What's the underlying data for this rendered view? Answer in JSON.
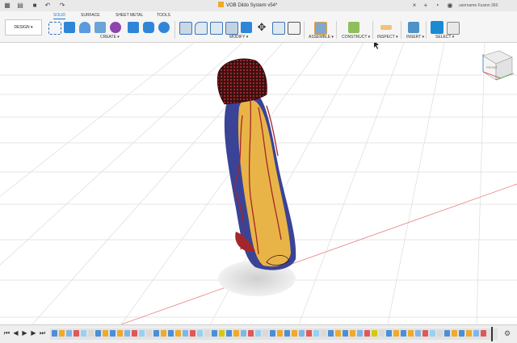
{
  "window": {
    "title": "VOB Dildo System v54*",
    "user": "username Fusion 360"
  },
  "toolbar": {
    "tabs": [
      "SOLID",
      "SURFACE",
      "SHEET METAL",
      "TOOLS"
    ],
    "active_tab": "SOLID",
    "workspace": "DESIGN ▾",
    "groups": [
      "CREATE ▾",
      "MODIFY ▾",
      "ASSEMBLE ▾",
      "CONSTRUCT ▾",
      "INSPECT ▾",
      "INSERT ▾",
      "SELECT ▾"
    ]
  },
  "icons": {
    "app_grid": "grid-icon",
    "file": "file-icon",
    "save": "save-icon",
    "undo": "undo-icon",
    "redo": "redo-icon",
    "close_tab": "close-icon",
    "new_tab": "plus-icon",
    "settings": "gear-icon"
  },
  "colors": {
    "accent": "#1a7ad4",
    "model_blue": "#3a4396",
    "model_yellow": "#e9b447",
    "model_red": "#a3262a",
    "tab_underline": "#1a7ad4",
    "timeline_marker": "#d7c80c"
  },
  "viewcube": {
    "face": "FRONT"
  }
}
